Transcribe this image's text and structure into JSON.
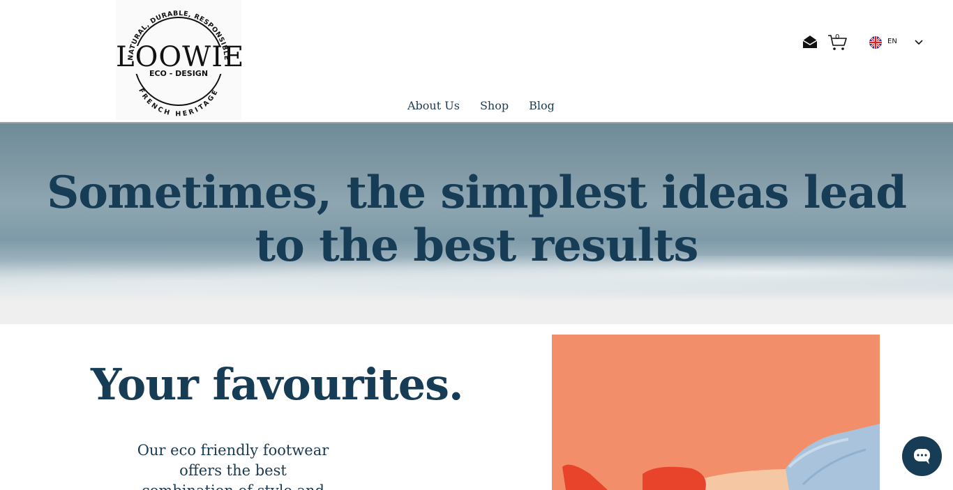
{
  "brand": {
    "name": "LOOWIE",
    "tagline_top": "NATURAL, DURABLE, RESPONSIBLE",
    "subtitle": "ECO - DESIGN",
    "tagline_bottom": "FRENCH HERITAGE"
  },
  "nav": {
    "items": [
      {
        "label": "About Us"
      },
      {
        "label": "Shop"
      },
      {
        "label": "Blog"
      }
    ]
  },
  "header_actions": {
    "mail_icon": "envelope-icon",
    "cart_icon": "cart-icon",
    "cart_count": "0",
    "language": "EN",
    "flag_icon": "uk-flag-icon"
  },
  "hero": {
    "line1": "Sometimes, the simplest ideas lead",
    "line2": "to the best results"
  },
  "favourites": {
    "title": "Your favourites.",
    "description": "Our eco friendly footwear offers the best combination of style and"
  },
  "chat": {
    "icon": "chat-bubble-icon"
  },
  "colors": {
    "brand_navy": "#173c55",
    "product_bg": "#f28f6a",
    "shoe_red": "#e8442c"
  }
}
